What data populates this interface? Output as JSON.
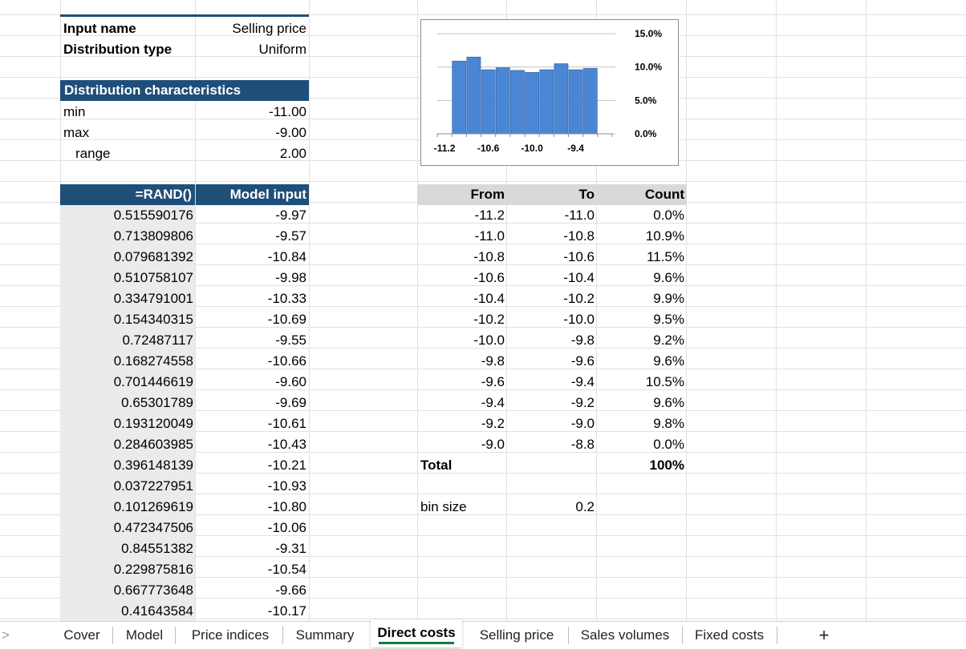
{
  "input": {
    "name_label": "Input name",
    "name_value": "Selling price",
    "dist_label": "Distribution type",
    "dist_value": "Uniform"
  },
  "characteristics": {
    "header": "Distribution characteristics",
    "rows": [
      {
        "label": "min",
        "value": "-11.00"
      },
      {
        "label": "max",
        "value": "-9.00"
      },
      {
        "label": "range",
        "value": "2.00"
      }
    ]
  },
  "sim_table": {
    "col1_header": "=RAND()",
    "col2_header": "Model input",
    "rows": [
      [
        "0.515590176",
        "-9.97"
      ],
      [
        "0.713809806",
        "-9.57"
      ],
      [
        "0.079681392",
        "-10.84"
      ],
      [
        "0.510758107",
        "-9.98"
      ],
      [
        "0.334791001",
        "-10.33"
      ],
      [
        "0.154340315",
        "-10.69"
      ],
      [
        "0.72487117",
        "-9.55"
      ],
      [
        "0.168274558",
        "-10.66"
      ],
      [
        "0.701446619",
        "-9.60"
      ],
      [
        "0.65301789",
        "-9.69"
      ],
      [
        "0.193120049",
        "-10.61"
      ],
      [
        "0.284603985",
        "-10.43"
      ],
      [
        "0.396148139",
        "-10.21"
      ],
      [
        "0.037227951",
        "-10.93"
      ],
      [
        "0.101269619",
        "-10.80"
      ],
      [
        "0.472347506",
        "-10.06"
      ],
      [
        "0.84551382",
        "-9.31"
      ],
      [
        "0.229875816",
        "-10.54"
      ],
      [
        "0.667773648",
        "-9.66"
      ],
      [
        "0.41643584",
        "-10.17"
      ]
    ]
  },
  "bin_table": {
    "headers": [
      "From",
      "To",
      "Count"
    ],
    "rows": [
      [
        "-11.2",
        "-11.0",
        "0.0%"
      ],
      [
        "-11.0",
        "-10.8",
        "10.9%"
      ],
      [
        "-10.8",
        "-10.6",
        "11.5%"
      ],
      [
        "-10.6",
        "-10.4",
        "9.6%"
      ],
      [
        "-10.4",
        "-10.2",
        "9.9%"
      ],
      [
        "-10.2",
        "-10.0",
        "9.5%"
      ],
      [
        "-10.0",
        "-9.8",
        "9.2%"
      ],
      [
        "-9.8",
        "-9.6",
        "9.6%"
      ],
      [
        "-9.6",
        "-9.4",
        "10.5%"
      ],
      [
        "-9.4",
        "-9.2",
        "9.6%"
      ],
      [
        "-9.2",
        "-9.0",
        "9.8%"
      ],
      [
        "-9.0",
        "-8.8",
        "0.0%"
      ]
    ],
    "total_label": "Total",
    "total_value": "100%",
    "bin_size_label": "bin size",
    "bin_size_value": "0.2"
  },
  "chart_data": {
    "type": "bar",
    "categories": [
      "-11.2",
      "-11.0",
      "-10.8",
      "-10.6",
      "-10.4",
      "-10.2",
      "-10.0",
      "-9.8",
      "-9.6",
      "-9.4",
      "-9.2",
      "-9.0"
    ],
    "values": [
      0.0,
      10.9,
      11.5,
      9.6,
      9.9,
      9.5,
      9.2,
      9.6,
      10.5,
      9.6,
      9.8,
      0.0
    ],
    "x_tick_labels": [
      "-11.2",
      "-10.6",
      "-10.0",
      "-9.4"
    ],
    "y_tick_labels": [
      "15.0%",
      "10.0%",
      "5.0%",
      "0.0%"
    ],
    "ylim": [
      0,
      15
    ],
    "y_axis_position": "right",
    "grid": true,
    "bar_color": "#4a86d4",
    "title": "",
    "xlabel": "",
    "ylabel": ""
  },
  "tabs": {
    "items": [
      "Cover",
      "Model",
      "Price indices",
      "Summary",
      "Direct costs",
      "Selling price",
      "Sales volumes",
      "Fixed costs"
    ],
    "active": "Direct costs",
    "add_label": "+",
    "scroll_label": ">"
  },
  "colors": {
    "header_blue": "#1f4e79",
    "active_tab_underline": "#107c41",
    "table_header_gray": "#d9d9d9"
  }
}
